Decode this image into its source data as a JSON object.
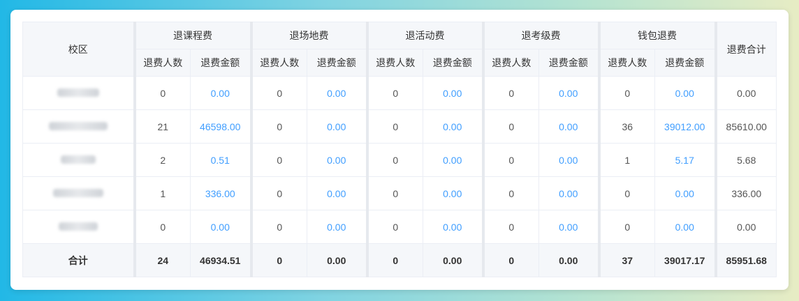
{
  "headers": {
    "campus": "校区",
    "groups": [
      "退课程费",
      "退场地费",
      "退活动费",
      "退考级费",
      "钱包退费"
    ],
    "sub_count": "退费人数",
    "sub_amount": "退费金额",
    "total": "退费合计"
  },
  "rows": [
    {
      "c": [
        "0",
        "0.00",
        "0",
        "0.00",
        "0",
        "0.00",
        "0",
        "0.00",
        "0",
        "0.00"
      ],
      "total": "0.00"
    },
    {
      "c": [
        "21",
        "46598.00",
        "0",
        "0.00",
        "0",
        "0.00",
        "0",
        "0.00",
        "36",
        "39012.00"
      ],
      "total": "85610.00"
    },
    {
      "c": [
        "2",
        "0.51",
        "0",
        "0.00",
        "0",
        "0.00",
        "0",
        "0.00",
        "1",
        "5.17"
      ],
      "total": "5.68"
    },
    {
      "c": [
        "1",
        "336.00",
        "0",
        "0.00",
        "0",
        "0.00",
        "0",
        "0.00",
        "0",
        "0.00"
      ],
      "total": "336.00"
    },
    {
      "c": [
        "0",
        "0.00",
        "0",
        "0.00",
        "0",
        "0.00",
        "0",
        "0.00",
        "0",
        "0.00"
      ],
      "total": "0.00"
    }
  ],
  "summary": {
    "label": "合计",
    "c": [
      "24",
      "46934.51",
      "0",
      "0.00",
      "0",
      "0.00",
      "0",
      "0.00",
      "37",
      "39017.17"
    ],
    "total": "85951.68"
  },
  "colors": {
    "link": "#409eff",
    "header_bg": "#f5f7fa"
  }
}
